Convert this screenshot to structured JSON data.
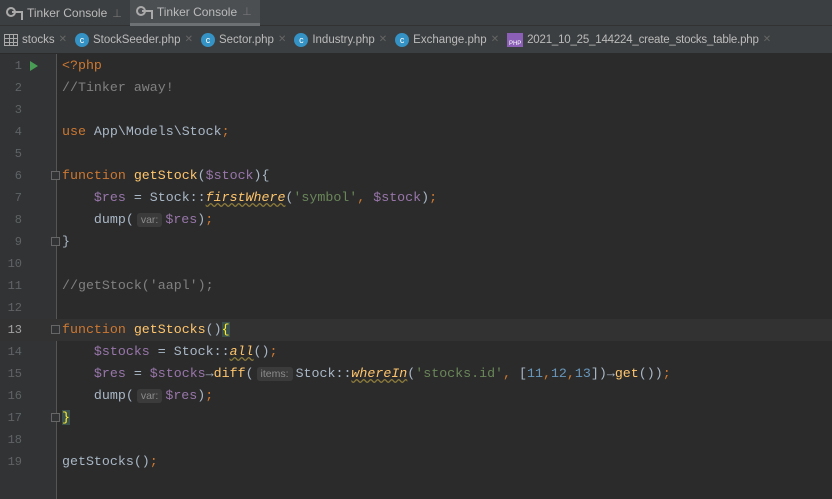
{
  "tool_tabs": [
    {
      "label": "Tinker Console",
      "active": false
    },
    {
      "label": "Tinker Console",
      "active": true
    }
  ],
  "file_tabs": [
    {
      "label": "stocks",
      "icon": "table-icon"
    },
    {
      "label": "StockSeeder.php",
      "icon": "class-icon"
    },
    {
      "label": "Sector.php",
      "icon": "class-icon"
    },
    {
      "label": "Industry.php",
      "icon": "class-icon"
    },
    {
      "label": "Exchange.php",
      "icon": "class-icon"
    },
    {
      "label": "2021_10_25_144224_create_stocks_table.php",
      "icon": "php-file-icon"
    }
  ],
  "current_line": 13,
  "lines": [
    [
      [
        "kw",
        "<?php"
      ]
    ],
    [
      [
        "cm",
        "//Tinker away!"
      ]
    ],
    [],
    [
      [
        "kw",
        "use "
      ],
      [
        "pl",
        "App\\Models\\Stock"
      ],
      [
        "kw",
        ";"
      ]
    ],
    [],
    [
      [
        "kw",
        "function "
      ],
      [
        "fn",
        "getStock"
      ],
      [
        "pl",
        "("
      ],
      [
        "var",
        "$stock"
      ],
      [
        "pl",
        "){"
      ]
    ],
    [
      [
        "pl",
        "    "
      ],
      [
        "var",
        "$res"
      ],
      [
        "pl",
        " = Stock::"
      ],
      [
        "it",
        "firstWhere"
      ],
      [
        "pl",
        "("
      ],
      [
        "str",
        "'symbol'"
      ],
      [
        "kw",
        ", "
      ],
      [
        "var",
        "$stock"
      ],
      [
        "pl",
        ")"
      ],
      [
        "kw",
        ";"
      ]
    ],
    [
      [
        "pl",
        "    dump("
      ],
      [
        "hint",
        "var:"
      ],
      [
        "var",
        "$res"
      ],
      [
        "pl",
        ")"
      ],
      [
        "kw",
        ";"
      ]
    ],
    [
      [
        "pl",
        "}"
      ]
    ],
    [],
    [
      [
        "cm",
        "//getStock('aapl');"
      ]
    ],
    [],
    [
      [
        "kw",
        "function "
      ],
      [
        "fn",
        "getStocks"
      ],
      [
        "pl",
        "()"
      ],
      [
        "brace",
        "{"
      ]
    ],
    [
      [
        "pl",
        "    "
      ],
      [
        "var",
        "$stocks"
      ],
      [
        "pl",
        " = Stock::"
      ],
      [
        "it",
        "all"
      ],
      [
        "pl",
        "()"
      ],
      [
        "kw",
        ";"
      ]
    ],
    [
      [
        "pl",
        "    "
      ],
      [
        "var",
        "$res"
      ],
      [
        "pl",
        " = "
      ],
      [
        "var",
        "$stocks"
      ],
      [
        "pl",
        "→"
      ],
      [
        "fn",
        "diff"
      ],
      [
        "pl",
        "("
      ],
      [
        "hint",
        "items:"
      ],
      [
        "pl",
        "Stock::"
      ],
      [
        "it",
        "whereIn"
      ],
      [
        "pl",
        "("
      ],
      [
        "str",
        "'stocks.id'"
      ],
      [
        "kw",
        ", "
      ],
      [
        "pl",
        "["
      ],
      [
        "num",
        "11"
      ],
      [
        "kw",
        ","
      ],
      [
        "num",
        "12"
      ],
      [
        "kw",
        ","
      ],
      [
        "num",
        "13"
      ],
      [
        "pl",
        "])→"
      ],
      [
        "fn",
        "get"
      ],
      [
        "pl",
        "())"
      ],
      [
        "kw",
        ";"
      ]
    ],
    [
      [
        "pl",
        "    dump("
      ],
      [
        "hint",
        "var:"
      ],
      [
        "var",
        "$res"
      ],
      [
        "pl",
        ")"
      ],
      [
        "kw",
        ";"
      ]
    ],
    [
      [
        "brace",
        "}"
      ]
    ],
    [],
    [
      [
        "pl",
        "getStocks()"
      ],
      [
        "kw",
        ";"
      ]
    ]
  ]
}
